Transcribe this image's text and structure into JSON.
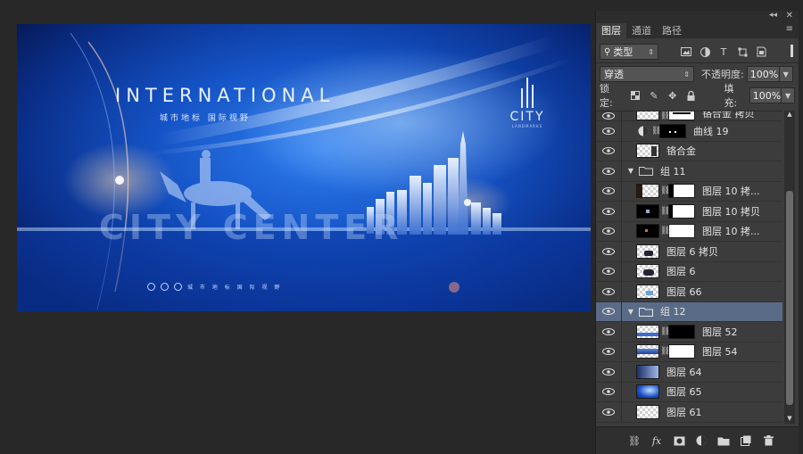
{
  "canvas": {
    "headline": "INTERNATIONAL",
    "subline": "城市地标   国际视野",
    "big_text": "CITY CENTER",
    "logo_text": "CITY",
    "logo_sub": "LANDMARKS",
    "footer_text": "城 市 地 标    国 际 视 野"
  },
  "panel": {
    "tabs": [
      {
        "label": "图层",
        "active": true
      },
      {
        "label": "通道",
        "active": false
      },
      {
        "label": "路径",
        "active": false
      }
    ],
    "filter_kind": "类型",
    "blend_mode": "穿透",
    "opacity_label": "不透明度:",
    "opacity_value": "100%",
    "lock_label": "锁定:",
    "fill_label": "填充:",
    "fill_value": "100%"
  },
  "layers": [
    {
      "name": "铬合金 拷贝",
      "kind": "masked"
    },
    {
      "name": "曲线 19",
      "kind": "adjustment"
    },
    {
      "name": "铬合金",
      "kind": "pixel"
    },
    {
      "name": "组 11",
      "kind": "group"
    },
    {
      "name": "图层 10 拷...",
      "kind": "masked"
    },
    {
      "name": "图层 10 拷贝",
      "kind": "masked"
    },
    {
      "name": "图层 10 拷...",
      "kind": "masked"
    },
    {
      "name": "图层 6 拷贝",
      "kind": "pixel"
    },
    {
      "name": "图层 6",
      "kind": "pixel"
    },
    {
      "name": "图层 66",
      "kind": "pixel"
    },
    {
      "name": "组 12",
      "kind": "group",
      "selected": true
    },
    {
      "name": "图层 52",
      "kind": "masked-black"
    },
    {
      "name": "图层 54",
      "kind": "masked"
    },
    {
      "name": "图层 64",
      "kind": "pixel"
    },
    {
      "name": "图层 65",
      "kind": "pixel"
    },
    {
      "name": "图层 61",
      "kind": "pixel"
    }
  ],
  "icons": {
    "eye": "eye-icon",
    "link": "link-icon",
    "folder": "folder-icon",
    "fx": "fx"
  },
  "colors": {
    "panel_bg": "#3c3c3c",
    "selected_row": "#5a6b87",
    "workspace": "#282828"
  }
}
